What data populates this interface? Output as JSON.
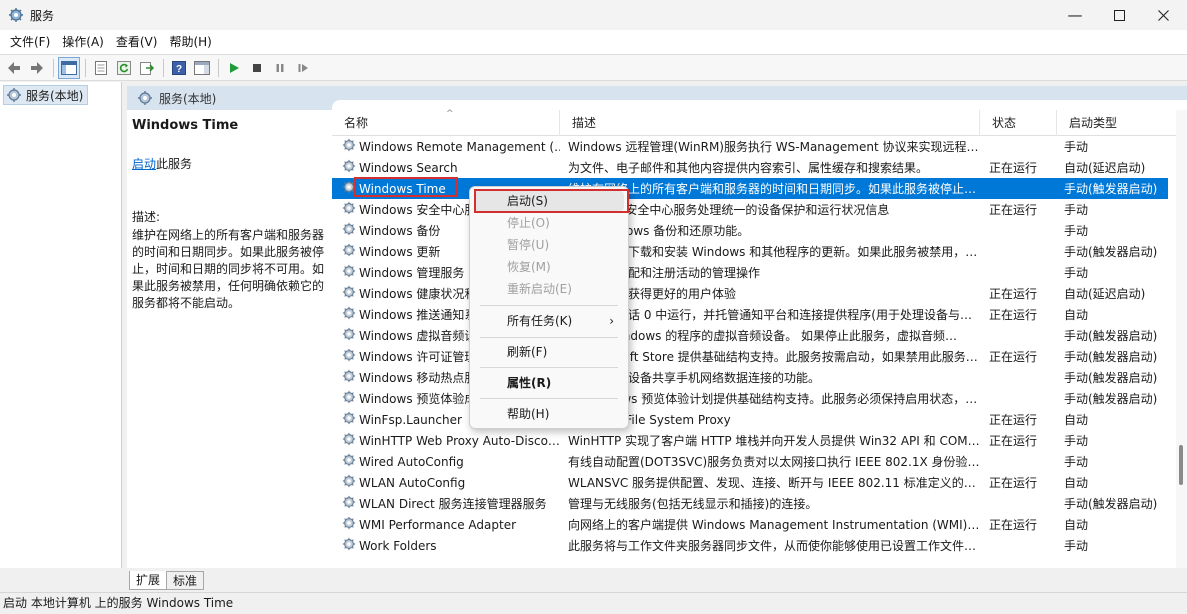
{
  "window": {
    "title": "服务"
  },
  "menu": [
    "文件(F)",
    "操作(A)",
    "查看(V)",
    "帮助(H)"
  ],
  "tree": {
    "root": "服务(本地)"
  },
  "panel": {
    "header": "服务(本地)"
  },
  "details": {
    "service_name": "Windows Time",
    "start_link": "启动",
    "start_suffix": "此服务",
    "desc_label": "描述:",
    "description": "维护在网络上的所有客户端和服务器的时间和日期同步。如果此服务被停止，时间和日期的同步将不可用。如果此服务被禁用，任何明确依赖它的服务都将不能启动。"
  },
  "columns": {
    "name": "名称",
    "desc": "描述",
    "status": "状态",
    "type": "启动类型"
  },
  "rows": [
    {
      "name": "Windows Remote Management (…",
      "desc": "Windows 远程管理(WinRM)服务执行 WS-Management 协议来实现远程…",
      "status": "",
      "type": "手动"
    },
    {
      "name": "Windows Search",
      "desc": "为文件、电子邮件和其他内容提供内容索引、属性缓存和搜索结果。",
      "status": "正在运行",
      "type": "自动(延迟启动)"
    },
    {
      "name": "Windows Time",
      "desc": "维护在网络上的所有客户端和服务器的时间和日期同步。如果此服务被停止…",
      "status": "",
      "type": "手动(触发器启动)"
    },
    {
      "name": "Windows 安全中心服务",
      "desc": "Windows 安全中心服务处理统一的设备保护和运行状况信息",
      "status": "正在运行",
      "type": "手动"
    },
    {
      "name": "Windows 备份",
      "desc": "提供 Windows 备份和还原功能。",
      "status": "",
      "type": "手动"
    },
    {
      "name": "Windows 更新",
      "desc": "启用检测、下载和安装 Windows 和其他程序的更新。如果此服务被禁用，…",
      "status": "",
      "type": "手动(触发器启动)"
    },
    {
      "name": "Windows 管理服务",
      "desc": "执行包括预配和注册活动的管理操作",
      "status": "",
      "type": "手动"
    },
    {
      "name": "Windows 健康状况和优化体验",
      "desc": "启用使用户获得更好的用户体验",
      "status": "正在运行",
      "type": "自动(延迟启动)"
    },
    {
      "name": "Windows 推送通知系统服务",
      "desc": "此服务在会话 0 中运行，并托管通知平台和连接提供程序(用于处理设备与…",
      "status": "正在运行",
      "type": "自动"
    },
    {
      "name": "Windows 虚拟音频设备",
      "desc": "为基于 Windows 的程序的虚拟音频设备。 如果停止此服务，虚拟音频…",
      "status": "",
      "type": "手动(触发器启动)"
    },
    {
      "name": "Windows 许可证管理器服务",
      "desc": "为 Microsoft Store 提供基础结构支持。此服务按需启动，如果禁用此服务…",
      "status": "正在运行",
      "type": "手动(触发器启动)"
    },
    {
      "name": "Windows 移动热点服务",
      "desc": "提供与其他设备共享手机网络数据连接的功能。",
      "status": "",
      "type": "手动(触发器启动)"
    },
    {
      "name": "Windows 预览体验成员服务",
      "desc": "为 Windows 预览体验计划提供基础结构支持。此服务必须保持启用状态，…",
      "status": "",
      "type": "手动(触发器启动)"
    },
    {
      "name": "WinFsp.Launcher",
      "desc": "Windows File System Proxy",
      "status": "正在运行",
      "type": "自动"
    },
    {
      "name": "WinHTTP Web Proxy Auto-Disco…",
      "desc": "WinHTTP 实现了客户端 HTTP 堆栈并向开发人员提供 Win32 API 和 COM…",
      "status": "正在运行",
      "type": "手动"
    },
    {
      "name": "Wired AutoConfig",
      "desc": "有线自动配置(DOT3SVC)服务负责对以太网接口执行 IEEE 802.1X 身份验…",
      "status": "",
      "type": "手动"
    },
    {
      "name": "WLAN AutoConfig",
      "desc": "WLANSVC 服务提供配置、发现、连接、断开与 IEEE 802.11 标准定义的…",
      "status": "正在运行",
      "type": "自动"
    },
    {
      "name": "WLAN Direct 服务连接管理器服务",
      "desc": "管理与无线服务(包括无线显示和插接)的连接。",
      "status": "",
      "type": "手动(触发器启动)"
    },
    {
      "name": "WMI Performance Adapter",
      "desc": "向网络上的客户端提供 Windows Management Instrumentation (WMI) …",
      "status": "正在运行",
      "type": "自动"
    },
    {
      "name": "Work Folders",
      "desc": "此服务将与工作文件夹服务器同步文件，从而使你能够使用已设置工作文件…",
      "status": "",
      "type": "手动"
    }
  ],
  "context_menu": {
    "start": "启动(S)",
    "stop": "停止(O)",
    "pause": "暂停(U)",
    "resume": "恢复(M)",
    "restart": "重新启动(E)",
    "all_tasks": "所有任务(K)",
    "refresh": "刷新(F)",
    "properties": "属性(R)",
    "help": "帮助(H)"
  },
  "tabs": {
    "extended": "扩展",
    "standard": "标准"
  },
  "status": "启动 本地计算机 上的服务 Windows Time"
}
